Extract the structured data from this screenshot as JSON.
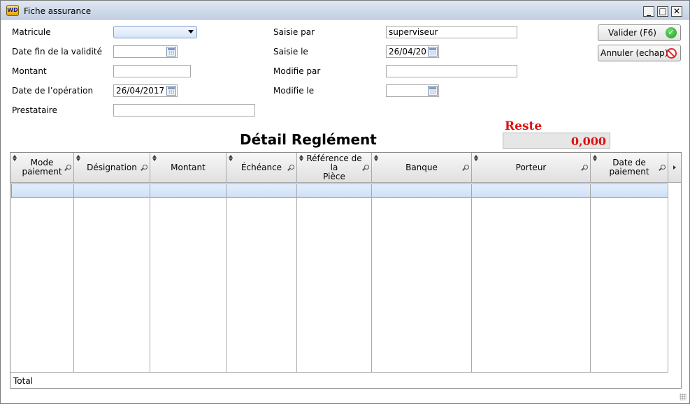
{
  "window": {
    "title": "Fiche assurance",
    "app_icon_text": "WD",
    "minimize_glyph": "_",
    "maximize_glyph": "□",
    "close_glyph": "✕"
  },
  "form": {
    "matricule_label": "Matricule",
    "matricule_value": "",
    "date_fin_label": "Date fin de la validité",
    "date_fin_value": "",
    "montant_label": "Montant",
    "montant_value": "",
    "date_operation_label": "Date de l’opération",
    "date_operation_value": "26/04/2017",
    "prestataire_label": "Prestataire",
    "prestataire_value": "",
    "saisie_par_label": "Saisie par",
    "saisie_par_value": "superviseur",
    "saisie_le_label": "Saisie le",
    "saisie_le_value": "26/04/20",
    "modifie_par_label": "Modifie par",
    "modifie_par_value": "",
    "modifie_le_label": "Modifie le",
    "modifie_le_value": ""
  },
  "buttons": {
    "valider_label": "Valider (F6)",
    "valider_icon": "check-circle-icon",
    "annuler_label": "Annuler (echap)",
    "annuler_icon": "forbidden-icon"
  },
  "detail": {
    "heading": "Détail Reglément",
    "reste_label": "Reste",
    "reste_value": "0,000"
  },
  "table": {
    "columns": [
      "Mode\npaiement",
      "Désignation",
      "Montant",
      "Échéance",
      "Référence de la\nPièce",
      "Banque",
      "Porteur",
      "Date de\npaiement"
    ],
    "total_label": "Total"
  },
  "colors": {
    "accent_red": "#e01010",
    "selected_row": "#cfe0f6",
    "titlebar": "#c3d0e2"
  }
}
